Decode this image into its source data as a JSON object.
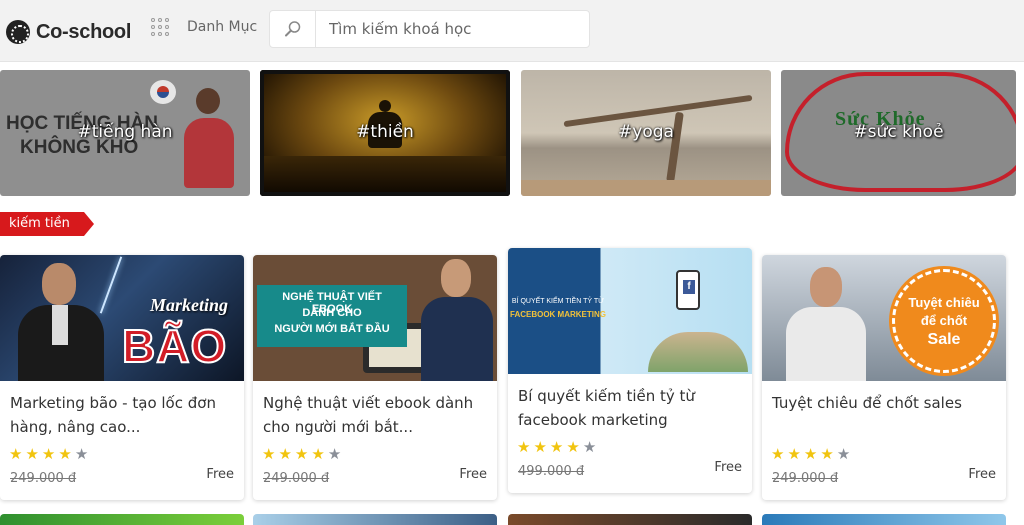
{
  "header": {
    "logo_text": "Co-school",
    "menu_label": "Danh Mục",
    "search_placeholder": "Tìm kiếm khoá học"
  },
  "topics": [
    {
      "label": "#tiếng hàn",
      "art_text": [
        "HỌC TIẾNG HÀN",
        "KHÔNG KHÓ"
      ]
    },
    {
      "label": "#thiền"
    },
    {
      "label": "#yoga"
    },
    {
      "label": "#sức khoẻ",
      "art_text": [
        "Sức Khỏe"
      ]
    }
  ],
  "category": "kiếm tiền",
  "courses": [
    {
      "title_line1": "Marketing bão - tạo lốc đơn",
      "title_line2": "hàng, nâng cao...",
      "rating": 4,
      "old_price": "249.000 đ",
      "price": "Free",
      "image_text": [
        "Marketing",
        "BÃO"
      ]
    },
    {
      "title_line1": "Nghệ thuật viết ebook dành",
      "title_line2": "cho người mới bắt...",
      "rating": 4,
      "old_price": "249.000 đ",
      "price": "Free",
      "image_text": [
        "NGHỆ THUẬT VIẾT EBOOK",
        "DÀNH CHO",
        "NGƯỜI MỚI BẮT ĐẦU"
      ]
    },
    {
      "title_line1": "Bí quyết kiếm tiền tỷ từ",
      "title_line2": "facebook marketing",
      "rating": 4,
      "old_price": "499.000 đ",
      "price": "Free",
      "image_text": [
        "BÍ QUYẾT KIẾM TIỀN TỶ TỪ",
        "FACEBOOK MARKETING"
      ]
    },
    {
      "title_line1": "Tuyệt chiêu để chốt sales",
      "title_line2": "",
      "rating": 4,
      "old_price": "249.000 đ",
      "price": "Free",
      "image_text": [
        "Tuyệt chiêu",
        "để chốt",
        "Sale"
      ]
    }
  ],
  "colors": {
    "accent_red": "#d7191c",
    "star": "#f1c40f",
    "star_off": "#8a8f98"
  },
  "icons": [
    "logo-icon",
    "grid-icon",
    "search-icon",
    "star-icon"
  ]
}
